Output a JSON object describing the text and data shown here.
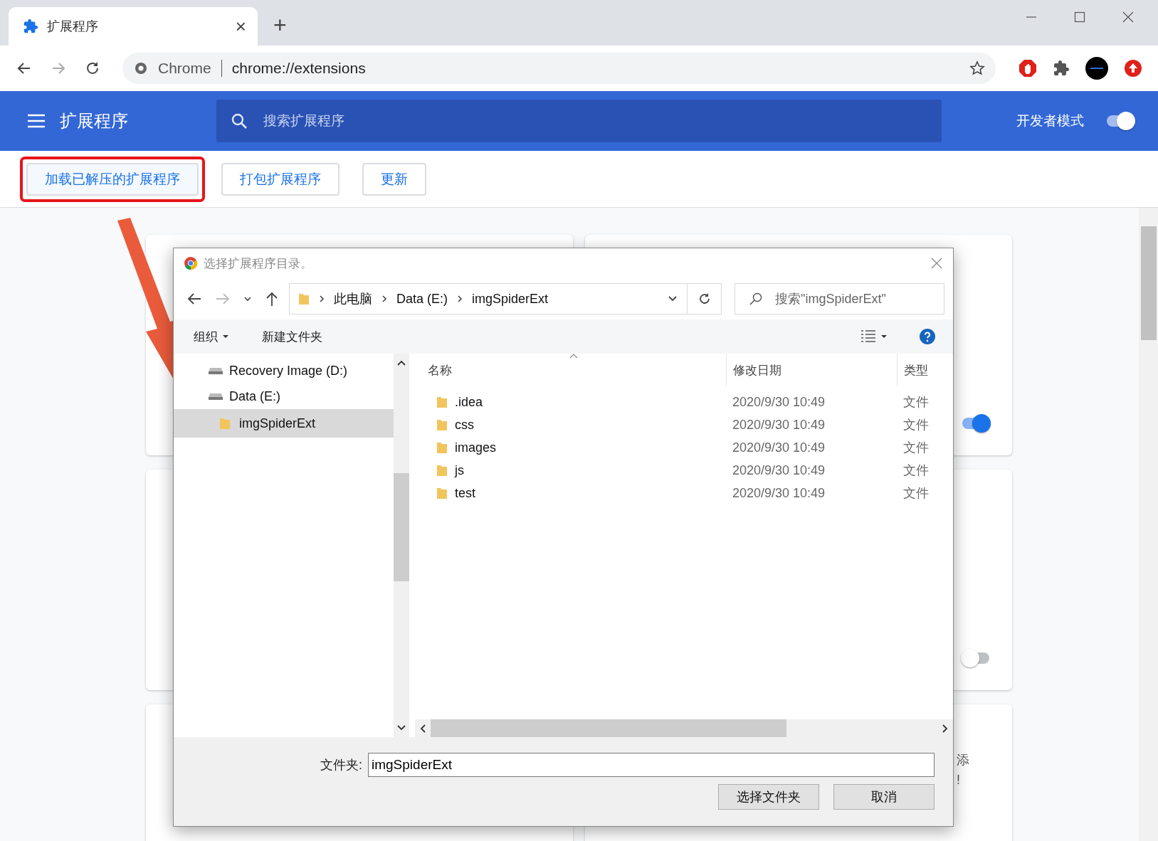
{
  "browser": {
    "tab": {
      "title": "扩展程序",
      "close": "×"
    },
    "new_tab": "+",
    "omnibox": {
      "site": "Chrome",
      "url": "chrome://extensions"
    }
  },
  "header": {
    "title": "扩展程序",
    "search": {
      "placeholder": "搜索扩展程序"
    },
    "dev_mode": {
      "label": "开发者模式",
      "on": true
    }
  },
  "actions": [
    {
      "label": "加载已解压的扩展程序",
      "highlighted": true
    },
    {
      "label": "打包扩展程序",
      "highlighted": false
    },
    {
      "label": "更新",
      "highlighted": false
    }
  ],
  "cards": [
    {
      "kind": "plain"
    },
    {
      "kind": "toggle",
      "toggle_on": true
    },
    {
      "kind": "plain"
    },
    {
      "kind": "toggle",
      "toggle_on": false
    },
    {
      "kind": "plain"
    },
    {
      "kind": "text",
      "texts": [
        "添",
        "!"
      ]
    }
  ],
  "dialog": {
    "title": "选择扩展程序目录。",
    "path": [
      "此电脑",
      "Data (E:)",
      "imgSpiderExt"
    ],
    "search": {
      "placeholder": "搜索\"imgSpiderExt\""
    },
    "toolbar": {
      "organize": "组织",
      "new_folder": "新建文件夹"
    },
    "tree": [
      {
        "label": "Recovery Image (D:)",
        "kind": "drive",
        "selected": false
      },
      {
        "label": "Data (E:)",
        "kind": "drive",
        "selected": false
      },
      {
        "label": "imgSpiderExt",
        "kind": "folder",
        "selected": true
      }
    ],
    "columns": [
      "名称",
      "修改日期",
      "类型"
    ],
    "rows": [
      {
        "name": ".idea",
        "date": "2020/9/30 10:49",
        "type": "文件"
      },
      {
        "name": "css",
        "date": "2020/9/30 10:49",
        "type": "文件"
      },
      {
        "name": "images",
        "date": "2020/9/30 10:49",
        "type": "文件"
      },
      {
        "name": "js",
        "date": "2020/9/30 10:49",
        "type": "文件"
      },
      {
        "name": "test",
        "date": "2020/9/30 10:49",
        "type": "文件"
      }
    ],
    "folder_label": "文件夹:",
    "folder_value": "imgSpiderExt",
    "buttons": [
      "选择文件夹",
      "取消"
    ]
  }
}
